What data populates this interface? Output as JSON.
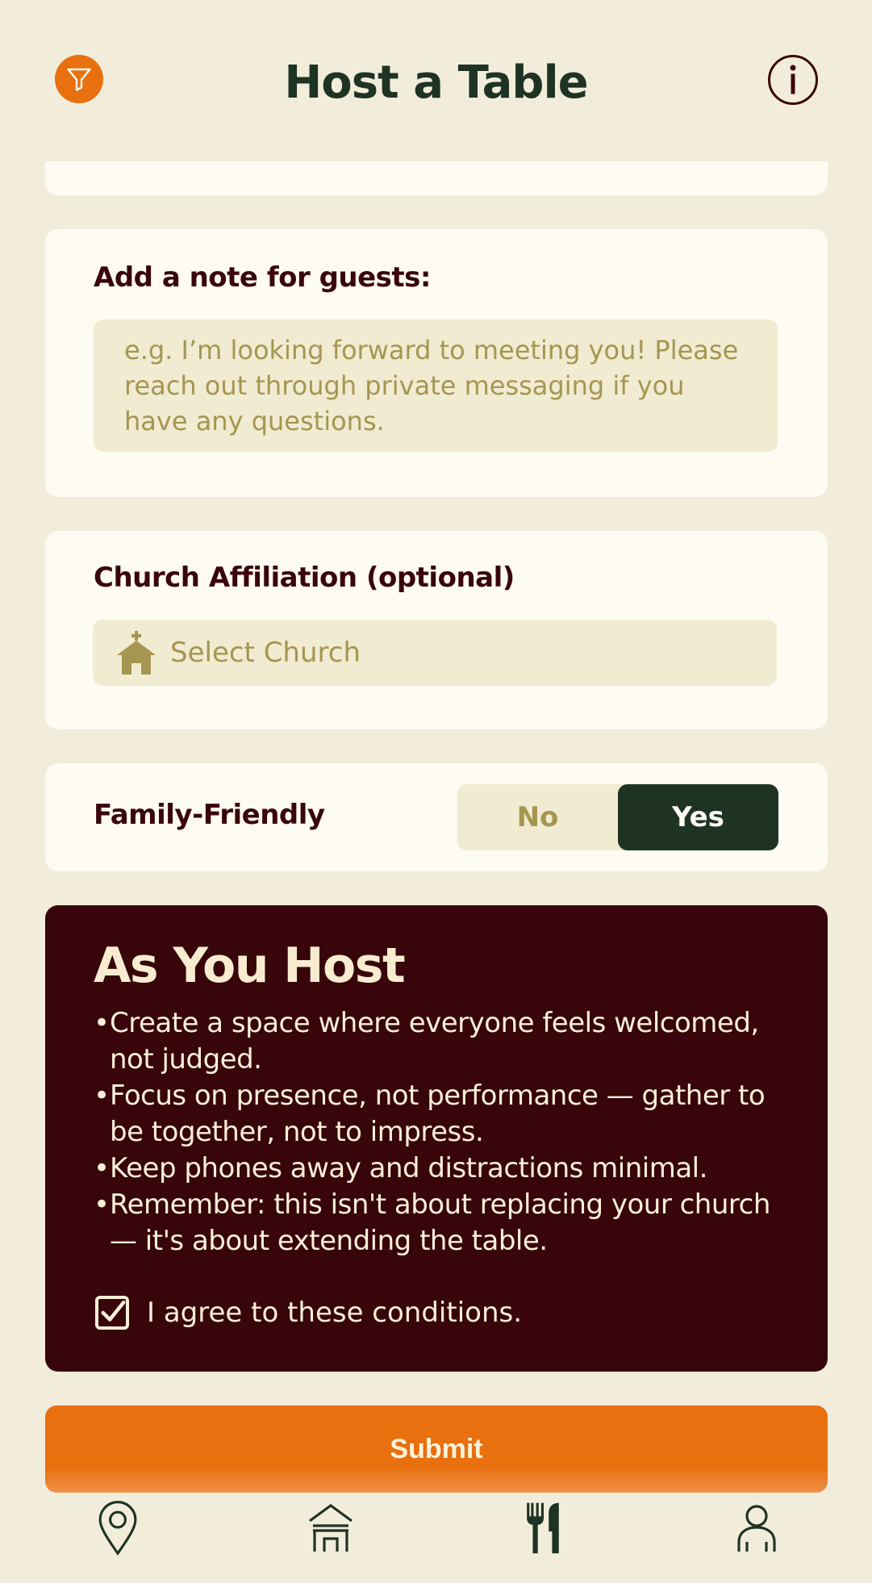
{
  "header": {
    "title": "Host a Table"
  },
  "note": {
    "label": "Add a note for guests:",
    "placeholder": "e.g. I’m looking forward to meeting you! Please reach out through private messaging if you have any questions."
  },
  "church": {
    "label": "Church Affiliation (optional)",
    "select_placeholder": "Select Church"
  },
  "family": {
    "label": "Family-Friendly",
    "options": [
      "No",
      "Yes"
    ],
    "selected": "Yes"
  },
  "host": {
    "title": "As You Host",
    "items": [
      "Create a space where everyone feels welcomed, not judged.",
      "Focus on presence, not performance — gather to be together, not to impress.",
      "Keep phones away and distractions minimal.",
      "Remember: this isn't about replacing your church — it's about extending the table."
    ],
    "agree_label": "I agree to these conditions.",
    "agreed": true
  },
  "submit_label": "Submit",
  "tabbar": {
    "tabs": [
      {
        "icon": "map-pin-icon",
        "active": false
      },
      {
        "icon": "home-icon",
        "active": false
      },
      {
        "icon": "fork-knife-icon",
        "active": true
      },
      {
        "icon": "profile-icon",
        "active": false
      }
    ]
  },
  "colors": {
    "background": "#f2eddb",
    "card": "#fdfbf2",
    "accent": "#e8700f",
    "dark_green": "#1f3324",
    "maroon": "#37050a",
    "muted_text": "#a59650"
  }
}
